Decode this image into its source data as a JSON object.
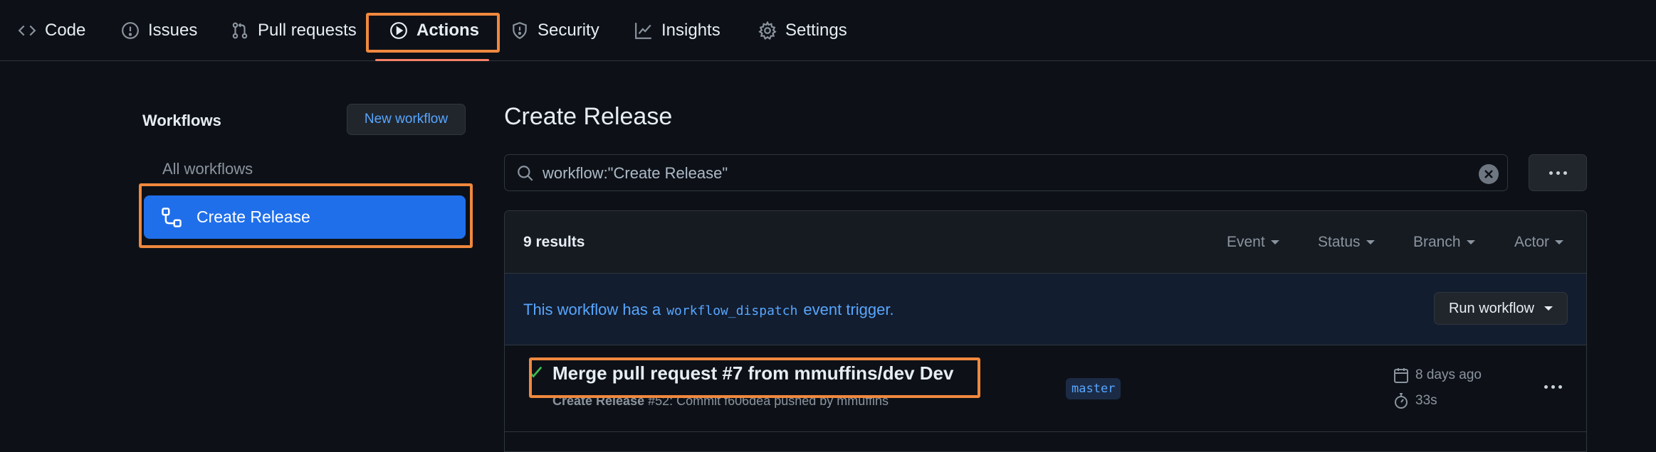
{
  "nav": {
    "tabs": [
      {
        "label": "Code",
        "icon": "code-icon"
      },
      {
        "label": "Issues",
        "icon": "issue-icon"
      },
      {
        "label": "Pull requests",
        "icon": "pull-request-icon"
      },
      {
        "label": "Actions",
        "icon": "play-icon"
      },
      {
        "label": "Security",
        "icon": "shield-icon"
      },
      {
        "label": "Insights",
        "icon": "graph-icon"
      },
      {
        "label": "Settings",
        "icon": "gear-icon"
      }
    ],
    "active": "Actions"
  },
  "sidebar": {
    "title": "Workflows",
    "new_workflow": "New workflow",
    "all_workflows": "All workflows",
    "selected_workflow": "Create Release"
  },
  "main": {
    "title": "Create Release",
    "search_value": "workflow:\"Create Release\"",
    "results": "9 results",
    "filters": [
      "Event",
      "Status",
      "Branch",
      "Actor"
    ],
    "dispatch": {
      "prefix": "This workflow has a",
      "code": "workflow_dispatch",
      "suffix": "event trigger.",
      "button": "Run workflow"
    },
    "runs": [
      {
        "title": "Merge pull request #7 from mmuffins/dev Dev",
        "workflow": "Create Release",
        "detail": "#52: Commit f606dea pushed by mmuffins",
        "branch": "master",
        "when": "8 days ago",
        "duration": "33s",
        "status": "success"
      }
    ]
  },
  "colors": {
    "background": "#0d1117",
    "accent": "#1f6feb",
    "link": "#58a6ff",
    "highlight": "#f0883e",
    "success": "#3fb950"
  }
}
